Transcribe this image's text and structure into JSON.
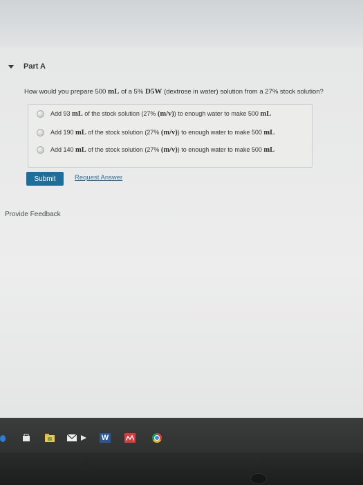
{
  "part": {
    "title": "Part A"
  },
  "question": {
    "prefix": "How would you prepare 500 ",
    "unit": "mL",
    "middle": " of a 5% ",
    "solution": "D5W",
    "suffix": " (dextrose in water) solution from a 27% stock solution?"
  },
  "choices": [
    {
      "prefix": "Add 93 ",
      "unit1": "mL",
      "middle": " of the stock solution (27% ",
      "mv": "(m/v)",
      "suffix": ") to enough water to make 500 ",
      "unit2": "mL"
    },
    {
      "prefix": "Add 190 ",
      "unit1": "mL",
      "middle": " of the stock solution (27% ",
      "mv": "(m/v)",
      "suffix": ") to enough water to make 500 ",
      "unit2": "mL"
    },
    {
      "prefix": "Add 140 ",
      "unit1": "mL",
      "middle": " of the stock solution (27% ",
      "mv": "(m/v)",
      "suffix": ") to enough water to make 500 ",
      "unit2": "mL"
    }
  ],
  "actions": {
    "submit_label": "Submit",
    "request_label": "Request Answer"
  },
  "feedback": {
    "label": "Provide Feedback"
  },
  "taskbar": {
    "icons": [
      "edge-icon",
      "store-icon",
      "explorer-icon",
      "mail-icon",
      "word-icon",
      "app-icon",
      "chrome-icon"
    ],
    "word_letter": "W"
  },
  "colors": {
    "accent": "#1d6e9a",
    "link": "#2d6fa0"
  }
}
